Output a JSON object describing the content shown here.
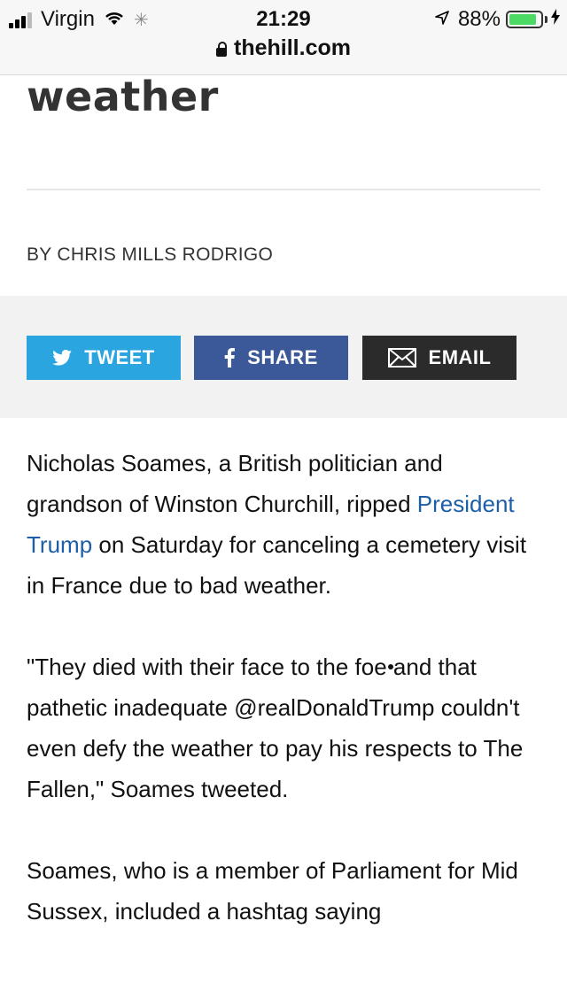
{
  "status_bar": {
    "carrier": "Virgin",
    "time": "21:29",
    "battery_percent": "88%",
    "battery_level": 0.88,
    "url": "thehill.com"
  },
  "article": {
    "headline_fragment": "weather",
    "byline": "BY CHRIS MILLS RODRIGO",
    "share": {
      "tweet_label": "TWEET",
      "share_label": "SHARE",
      "email_label": "EMAIL"
    },
    "paragraph1_before": "Nicholas Soames, a British politician and grandson of Winston Churchill, ripped ",
    "paragraph1_link": "President Trump",
    "paragraph1_after": " on Saturday for canceling a cemetery visit in France due to bad weather.",
    "paragraph2": "\"They died with their face to the foe and that pathetic inadequate @realDonaldTrump couldn't even defy the weather to pay his respects to The Fallen,\" Soames tweeted.",
    "paragraph3": "Soames, who is a member of Parliament for Mid Sussex, included a hashtag saying"
  },
  "colors": {
    "twitter": "#2ba5e0",
    "facebook": "#3b5998",
    "email": "#2b2b2b",
    "link": "#1d5ea8",
    "battery": "#4cd964"
  }
}
